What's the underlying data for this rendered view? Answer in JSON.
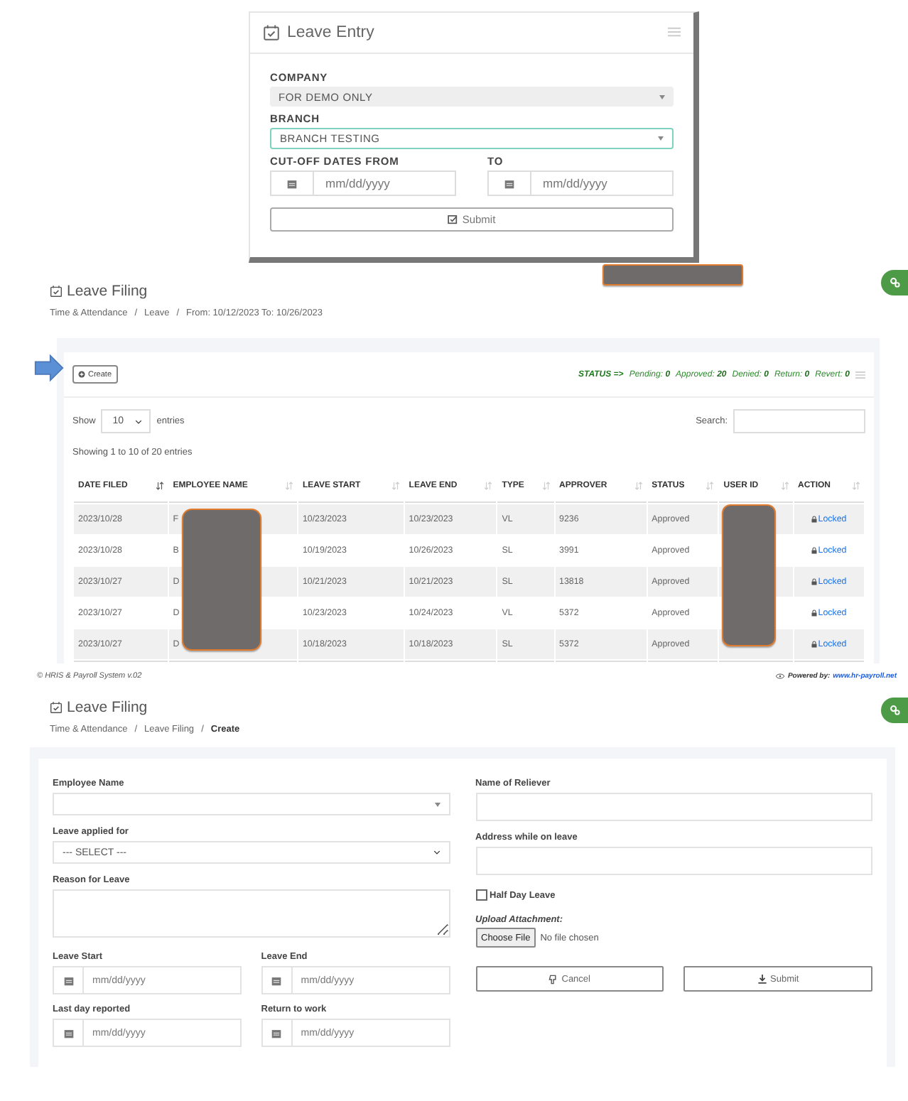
{
  "leave_entry": {
    "title": "Leave Entry",
    "company": {
      "label": "COMPANY",
      "value": "FOR DEMO ONLY"
    },
    "branch": {
      "label": "BRANCH",
      "value": "BRANCH TESTING"
    },
    "date_from": {
      "label": "CUT-OFF DATES FROM",
      "placeholder": "mm/dd/yyyy"
    },
    "date_to": {
      "label": "TO",
      "placeholder": "mm/dd/yyyy"
    },
    "submit": "Submit"
  },
  "filing": {
    "title": "Leave Filing",
    "breadcrumb": [
      {
        "label": "Time & Attendance",
        "current": false,
        "separator": "/"
      },
      {
        "label": "Leave",
        "current": false,
        "separator": "/"
      },
      {
        "label": "From: 10/12/2023 To: 10/26/2023",
        "current": false
      }
    ],
    "create": "Create",
    "status_label": "STATUS =>",
    "status_counts": [
      {
        "label": "Pending:",
        "value": "0"
      },
      {
        "label": "Approved:",
        "value": "20"
      },
      {
        "label": "Denied:",
        "value": "0"
      },
      {
        "label": "Return:",
        "value": "0"
      },
      {
        "label": "Revert:",
        "value": "0"
      }
    ],
    "show": "Show",
    "page_size": "10",
    "entries": "entries",
    "search_label": "Search:",
    "info": "Showing 1 to 10 of 20 entries",
    "table": {
      "columns": [
        {
          "label": "DATE FILED",
          "sorted": true
        },
        {
          "label": "EMPLOYEE NAME",
          "sorted": false
        },
        {
          "label": "LEAVE START",
          "sorted": false
        },
        {
          "label": "LEAVE END",
          "sorted": false
        },
        {
          "label": "TYPE",
          "sorted": false
        },
        {
          "label": "APPROVER",
          "sorted": false
        },
        {
          "label": "STATUS",
          "sorted": false
        },
        {
          "label": "USER ID",
          "sorted": false
        },
        {
          "label": "ACTION",
          "sorted": false
        }
      ],
      "rows": [
        [
          "2023/10/28",
          "F",
          "10/23/2023",
          "10/23/2023",
          "VL",
          "9236",
          "Approved",
          "",
          "Locked"
        ],
        [
          "2023/10/28",
          "B",
          "10/19/2023",
          "10/26/2023",
          "SL",
          "3991",
          "Approved",
          "",
          "Locked"
        ],
        [
          "2023/10/27",
          "D",
          "10/21/2023",
          "10/21/2023",
          "SL",
          "13818",
          "Approved",
          "",
          "Locked"
        ],
        [
          "2023/10/27",
          "D",
          "10/23/2023",
          "10/24/2023",
          "VL",
          "5372",
          "Approved",
          "",
          "Locked"
        ],
        [
          "2023/10/27",
          "D",
          "10/18/2023",
          "10/18/2023",
          "SL",
          "5372",
          "Approved",
          "",
          "Locked"
        ]
      ]
    }
  },
  "footer": {
    "copyright": "© HRIS & Payroll System v.02",
    "powered_label": "Powered by:",
    "powered_link": "www.hr-payroll.net"
  },
  "create_form": {
    "title": "Leave Filing",
    "breadcrumb": [
      {
        "label": "Time & Attendance",
        "current": false,
        "separator": "/"
      },
      {
        "label": "Leave Filing",
        "current": false,
        "separator": "/"
      },
      {
        "label": "Create",
        "current": true
      }
    ],
    "employee_name": "Employee Name",
    "leave_applied_for": {
      "label": "Leave applied for",
      "value": "--- SELECT ---"
    },
    "reason": "Reason for Leave",
    "dates": [
      {
        "label": "Leave Start",
        "placeholder": "mm/dd/yyyy"
      },
      {
        "label": "Leave End",
        "placeholder": "mm/dd/yyyy"
      },
      {
        "label": "Last day reported",
        "placeholder": "mm/dd/yyyy"
      },
      {
        "label": "Return to work",
        "placeholder": "mm/dd/yyyy"
      }
    ],
    "reliever": "Name of Reliever",
    "address": "Address while on leave",
    "half_day": {
      "label": "Half Day Leave",
      "checked": false
    },
    "upload_label": "Upload Attachment:",
    "choose_file": "Choose File",
    "no_file": "No file chosen",
    "cancel": "Cancel",
    "submit": "Submit"
  }
}
